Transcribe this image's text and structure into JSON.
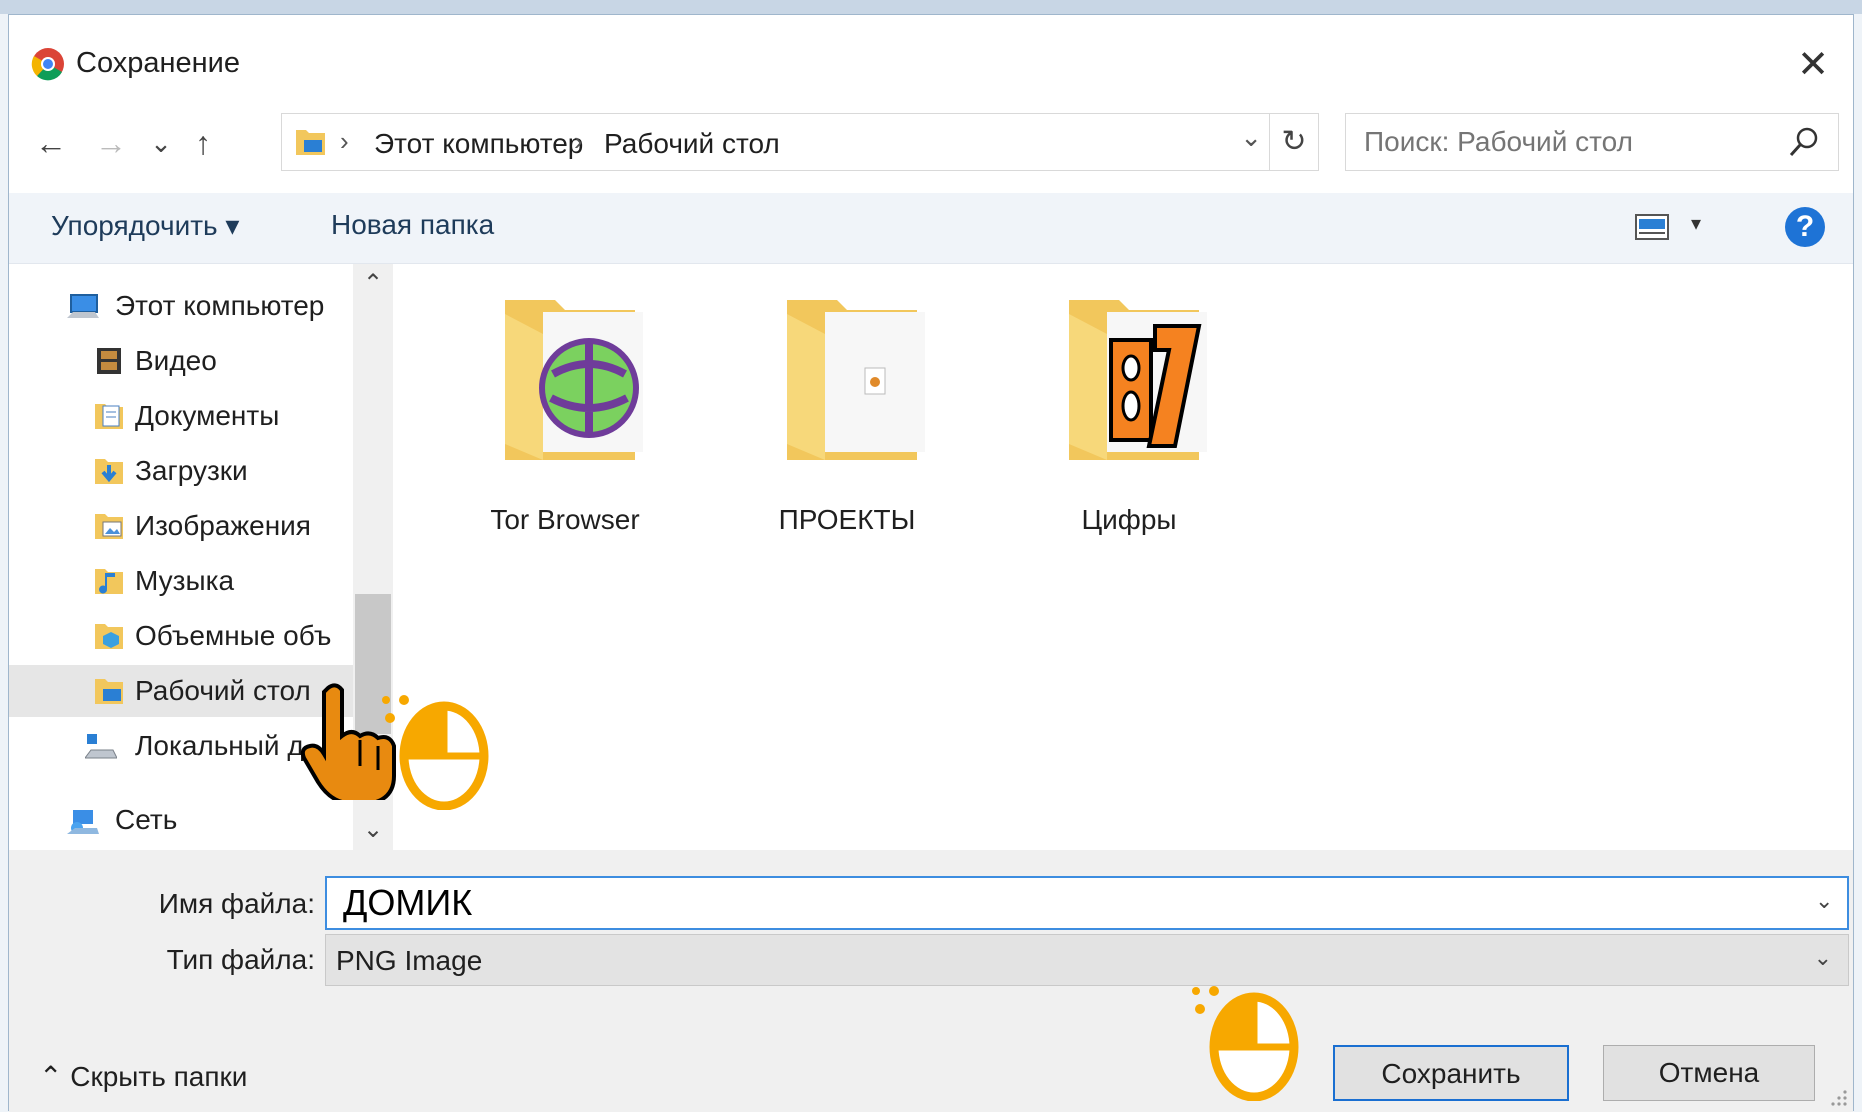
{
  "window": {
    "title": "Сохранение",
    "close_symbol": "✕"
  },
  "nav": {
    "back": "←",
    "forward": "→",
    "recent": "⌄",
    "up": "↑"
  },
  "address": {
    "crumbs": [
      "Этот компьютер",
      "Рабочий стол"
    ],
    "separator": "›",
    "dropdown": "⌄",
    "refresh": "↻"
  },
  "search": {
    "placeholder": "Поиск: Рабочий стол"
  },
  "toolbar": {
    "organize": "Упорядочить ▾",
    "new_folder": "Новая папка",
    "view_dropdown": "▾",
    "help": "?"
  },
  "tree": {
    "items": [
      {
        "label": "Этот компьютер",
        "icon": "computer-icon"
      },
      {
        "label": "Видео",
        "icon": "video-folder-icon"
      },
      {
        "label": "Документы",
        "icon": "documents-folder-icon"
      },
      {
        "label": "Загрузки",
        "icon": "downloads-folder-icon"
      },
      {
        "label": "Изображения",
        "icon": "pictures-folder-icon"
      },
      {
        "label": "Музыка",
        "icon": "music-folder-icon"
      },
      {
        "label": "Объемные объ",
        "icon": "3d-objects-folder-icon"
      },
      {
        "label": "Рабочий стол",
        "icon": "desktop-folder-icon"
      },
      {
        "label": "Локальный д",
        "icon": "local-disk-icon"
      },
      {
        "label": "Сеть",
        "icon": "network-icon"
      }
    ],
    "scroll_up": "⌃",
    "scroll_down": "⌄"
  },
  "files": [
    {
      "name": "Tor Browser",
      "icon": "tor-browser-folder-icon"
    },
    {
      "name": "ПРОЕКТЫ",
      "icon": "folder-icon"
    },
    {
      "name": "Цифры",
      "icon": "numbers-folder-icon"
    }
  ],
  "form": {
    "file_name_label": "Имя файла:",
    "file_name_value": "ДОМИК",
    "file_type_label": "Тип файла:",
    "file_type_value": "PNG Image",
    "dropdown": "⌄"
  },
  "footer": {
    "hide_folders": "⌃ Скрыть папки",
    "save": "Сохранить",
    "cancel": "Отмена"
  },
  "colors": {
    "accent": "#1a6fd1",
    "overlay": "#f7a800",
    "hand": "#e88a10"
  }
}
